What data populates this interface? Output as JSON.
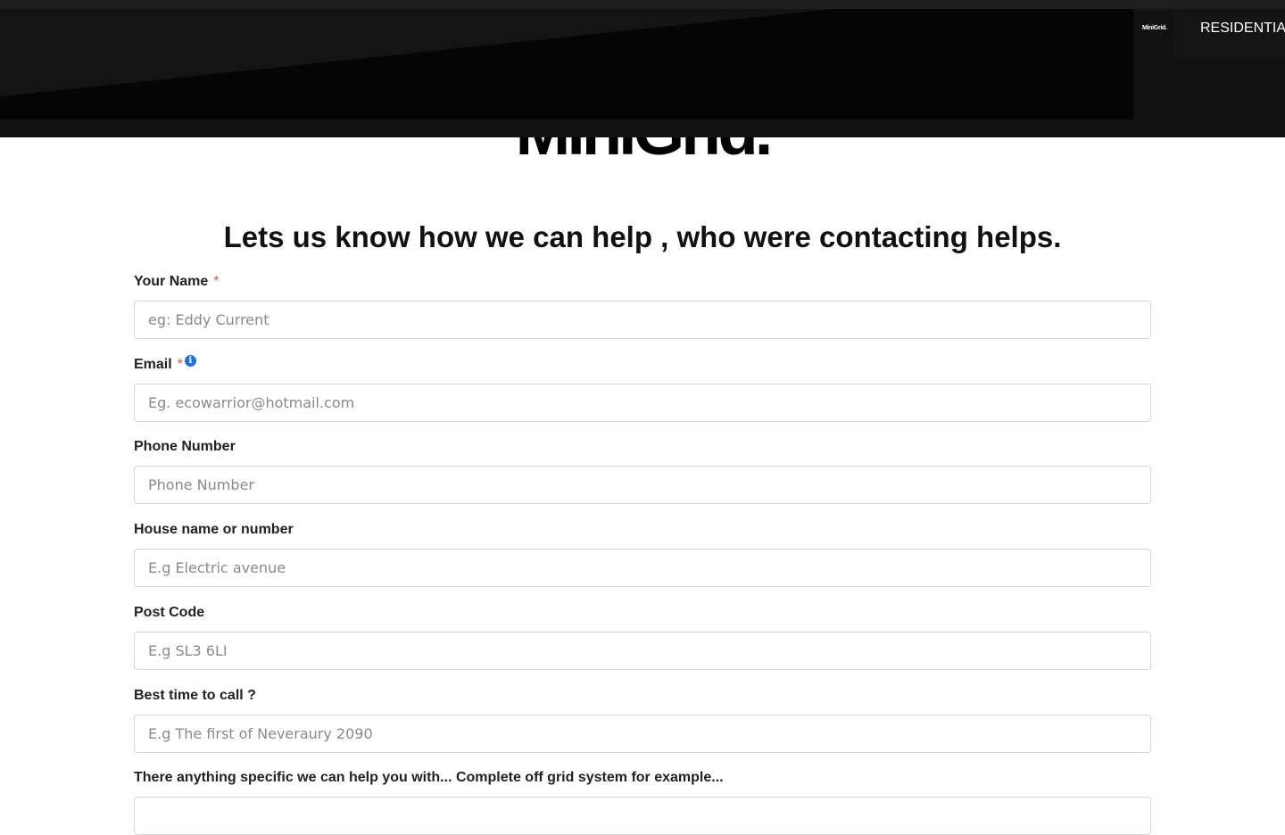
{
  "nav": {
    "logo_text": "MiniGrid.",
    "item_label": "RESIDENTIAL"
  },
  "brand": {
    "logo_text": "MiniGrid."
  },
  "page": {
    "heading": "Lets us know how we can help , who were contacting helps."
  },
  "form": {
    "required_mark": "*",
    "fields": [
      {
        "label": "Your Name",
        "placeholder": "eg: Eddy Current",
        "required": true
      },
      {
        "label": "Email",
        "placeholder": "Eg. ecowarrior@hotmail.com",
        "required": true,
        "info_icon": "info-icon"
      },
      {
        "label": "Phone Number",
        "placeholder": "Phone Number"
      },
      {
        "label": "House name or number",
        "placeholder": "E.g Electric avenue"
      },
      {
        "label": "Post Code",
        "placeholder": "E.g SL3 6LI"
      },
      {
        "label": "Best time to call ?",
        "placeholder": "E.g The first of Neveraury 2090"
      },
      {
        "label": "There anything specific we can help you with... Complete off grid system for example..."
      }
    ]
  },
  "colors": {
    "header_bg": "#111111",
    "required": "#e0534a",
    "info": "#1f73e0",
    "input_border": "#d4d4d4"
  }
}
